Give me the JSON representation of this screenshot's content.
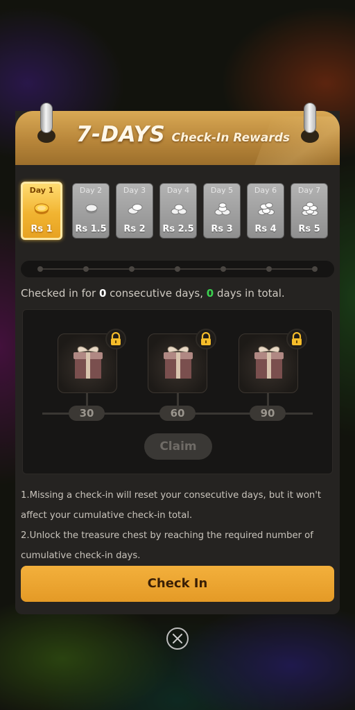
{
  "header": {
    "title_main": "7-DAYS",
    "title_sub": "Check-In Rewards"
  },
  "days": [
    {
      "label": "Day 1",
      "reward": "Rs 1",
      "active": true
    },
    {
      "label": "Day 2",
      "reward": "Rs 1.5",
      "active": false
    },
    {
      "label": "Day 3",
      "reward": "Rs 2",
      "active": false
    },
    {
      "label": "Day 4",
      "reward": "Rs 2.5",
      "active": false
    },
    {
      "label": "Day 5",
      "reward": "Rs 3",
      "active": false
    },
    {
      "label": "Day 6",
      "reward": "Rs 4",
      "active": false
    },
    {
      "label": "Day 7",
      "reward": "Rs 5",
      "active": false
    }
  ],
  "stats": {
    "prefix": "Checked in for ",
    "consecutive": "0",
    "middle": " consecutive days, ",
    "total": "0",
    "suffix": " days in total."
  },
  "chests": [
    {
      "days": "30",
      "icon": "gift-icon",
      "locked": true
    },
    {
      "days": "60",
      "icon": "gift-icon",
      "locked": true
    },
    {
      "days": "90",
      "icon": "gift-icon",
      "locked": true
    }
  ],
  "claim_label": "Claim",
  "rules": [
    "1.Missing a check-in will reset your consecutive days, but it won't affect your cumulative check-in total.",
    "2.Unlock the treasure chest by reaching the required number of cumulative check-in days."
  ],
  "checkin_label": "Check In",
  "colors": {
    "accent": "#e8a22a",
    "active_day": "#f1b431",
    "highlight_green": "#3bd24f",
    "panel": "#252321"
  }
}
